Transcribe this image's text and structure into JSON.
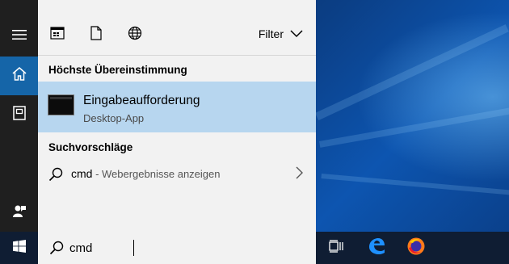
{
  "toolbar": {
    "icons": [
      "apps-icon",
      "documents-icon",
      "web-icon"
    ],
    "filter_label": "Filter"
  },
  "best_match": {
    "section_title": "Höchste Übereinstimmung",
    "app_name": "Eingabeaufforderung",
    "app_type": "Desktop-App"
  },
  "suggestions": {
    "section_title": "Suchvorschläge",
    "items": [
      {
        "query": "cmd",
        "detail": " - Webergebnisse anzeigen"
      }
    ]
  },
  "search": {
    "value": "cmd"
  },
  "rail": {
    "icons": [
      "hamburger-menu-icon",
      "home-icon",
      "notebook-icon",
      "feedback-icon"
    ]
  },
  "taskbar": {
    "apps": [
      "task-view-icon",
      "edge-icon",
      "firefox-icon"
    ]
  },
  "colors": {
    "accent": "#1565a8",
    "selection": "#b7d6ef",
    "panel": "#f2f2f2",
    "rail": "#1f1f1f",
    "taskbar": "#0f1d33"
  }
}
